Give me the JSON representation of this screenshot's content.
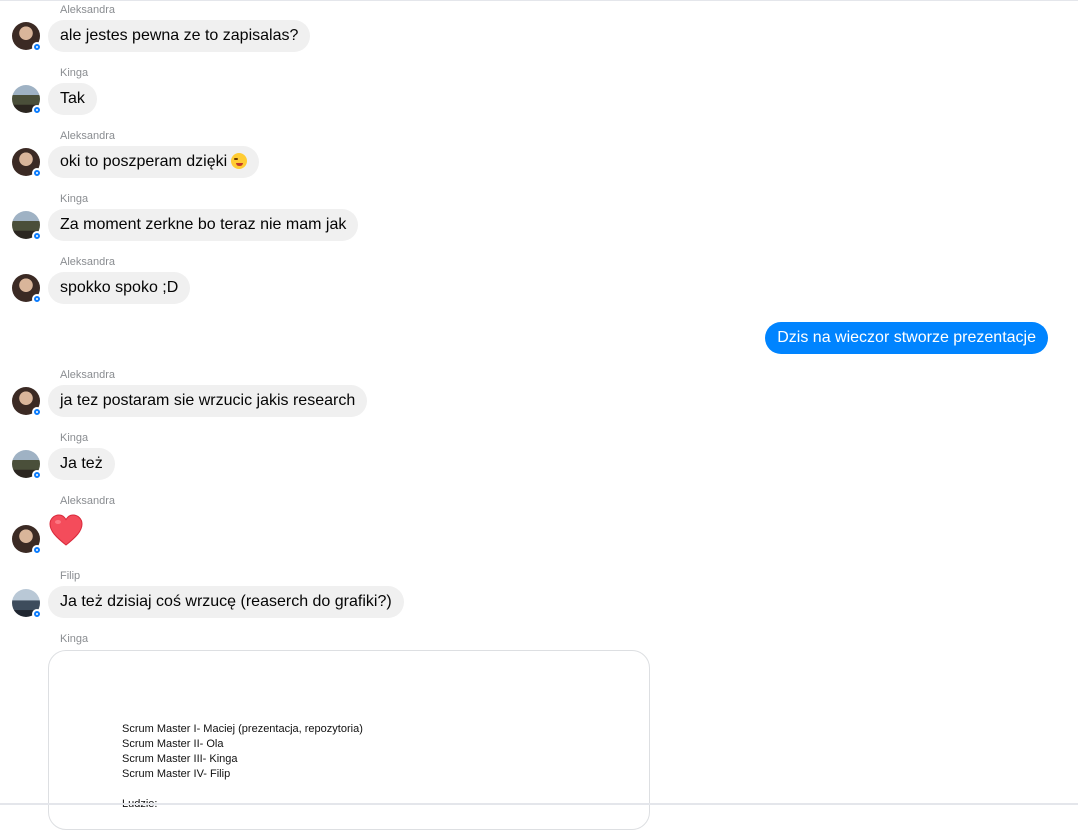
{
  "messages": [
    {
      "sender": "Aleksandra",
      "text": "ale jestes pewna ze to zapisalas?"
    },
    {
      "sender": "Kinga",
      "text": "Tak"
    },
    {
      "sender": "Aleksandra",
      "text": "oki to poszperam dzięki",
      "emoji": "winking-tongue-emoji"
    },
    {
      "sender": "Kinga",
      "text": "Za moment zerkne bo teraz nie mam jak"
    },
    {
      "sender": "Aleksandra",
      "text": "spokko spoko ;D"
    },
    {
      "sender": "Me",
      "text": "Dzis na wieczor stworze prezentacje"
    },
    {
      "sender": "Aleksandra",
      "text": "ja tez postaram sie wrzucic jakis research"
    },
    {
      "sender": "Kinga",
      "text": "Ja też"
    },
    {
      "sender": "Aleksandra",
      "emoji": "red-heart-emoji"
    },
    {
      "sender": "Filip",
      "text": "Ja też dzisiaj coś wrzucę (reaserch do grafiki?)"
    },
    {
      "sender": "Kinga",
      "attachment": {
        "lines": [
          "Scrum Master I- Maciej (prezentacja, repozytoria)",
          "Scrum Master II- Ola",
          "Scrum Master III- Kinga",
          "Scrum Master IV- Filip",
          "",
          "Ludzie:"
        ]
      }
    }
  ],
  "colors": {
    "incoming_bubble": "#f0f0f0",
    "outgoing_bubble": "#0084ff",
    "sender_label": "#8a8d91",
    "badge": "#0a7cff"
  }
}
